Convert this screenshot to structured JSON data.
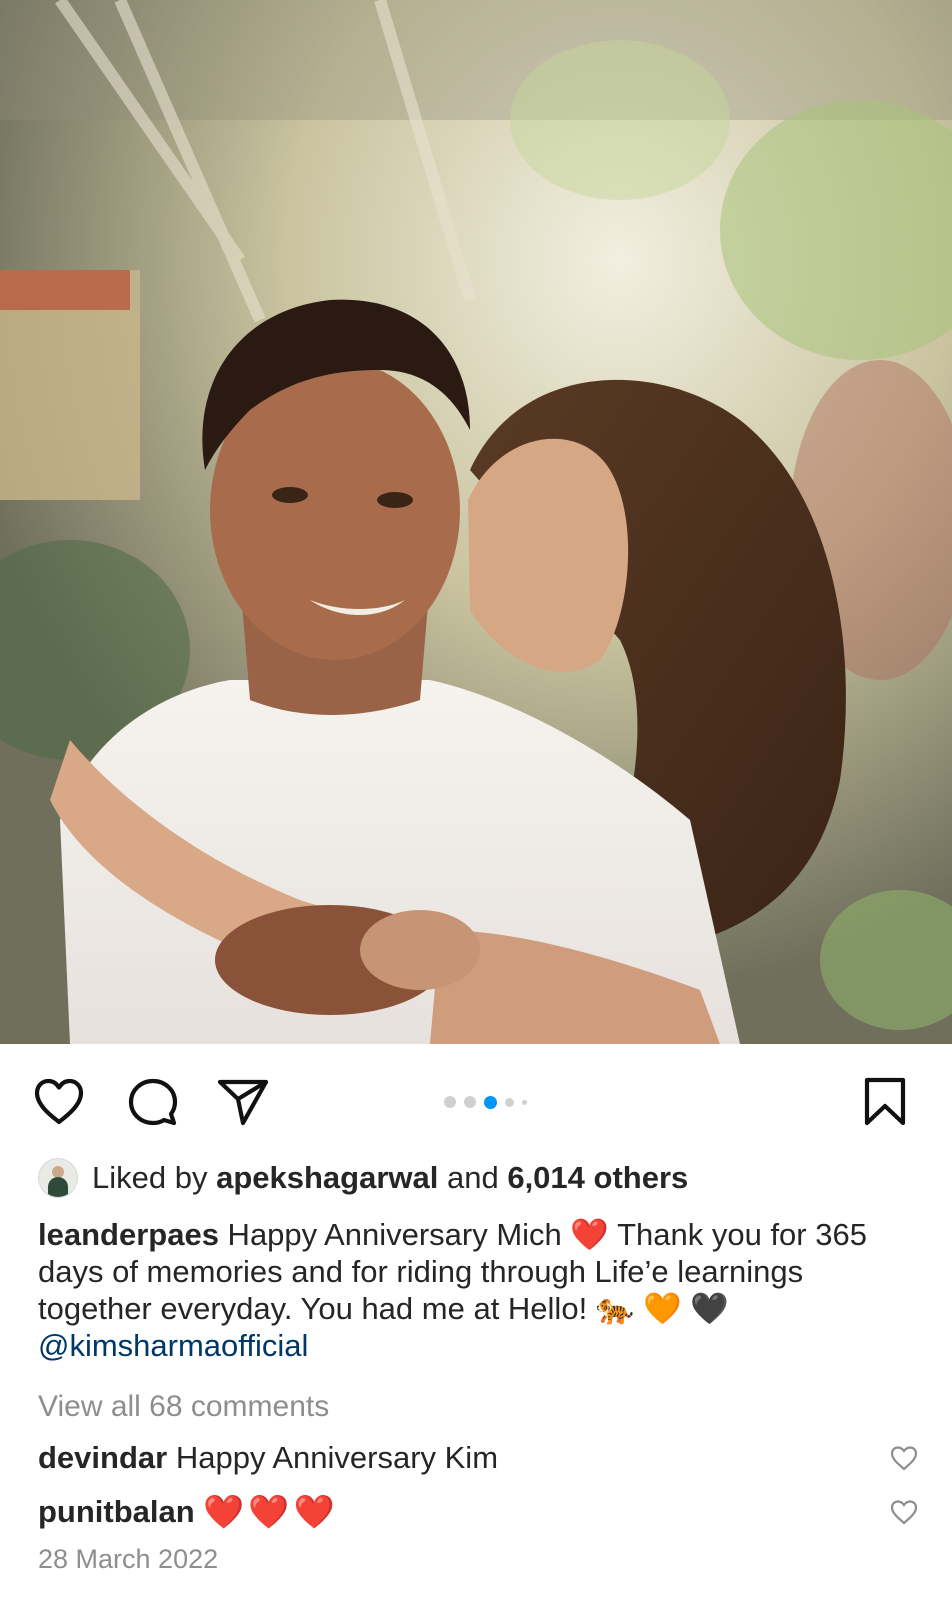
{
  "post": {
    "photo_alt": "photo",
    "carousel": {
      "count": 5,
      "active_index": 2
    },
    "actions": {
      "like_icon": "heart-outline-icon",
      "comment_icon": "comment-bubble-icon",
      "share_icon": "paper-plane-icon",
      "save_icon": "bookmark-icon"
    },
    "likes": {
      "prefix": "Liked by ",
      "user": "apekshagarwal",
      "middle": " and ",
      "count": "6,014 others"
    },
    "caption": {
      "username": "leanderpaes",
      "text1": " Happy Anniversary Mich ",
      "heart1": "❤️",
      "text2": " Thank you for 365 days of memories and for riding through Life’e learnings together everyday. You had me at Hello! ",
      "tiger": "🐅",
      "orange_heart": "🧡",
      "black_heart": "🖤",
      "mention": "@kimsharmaofficial"
    },
    "view_comments": "View all 68 comments",
    "comments": [
      {
        "username": "devindar",
        "text": " Happy Anniversary Kim"
      },
      {
        "username": "punitbalan",
        "text": "❤️❤️❤️"
      }
    ],
    "date": "28 March 2022",
    "colors": {
      "accent": "#0095f6",
      "mention": "#00376b",
      "muted": "#8e8e8e",
      "text": "#262626"
    }
  }
}
